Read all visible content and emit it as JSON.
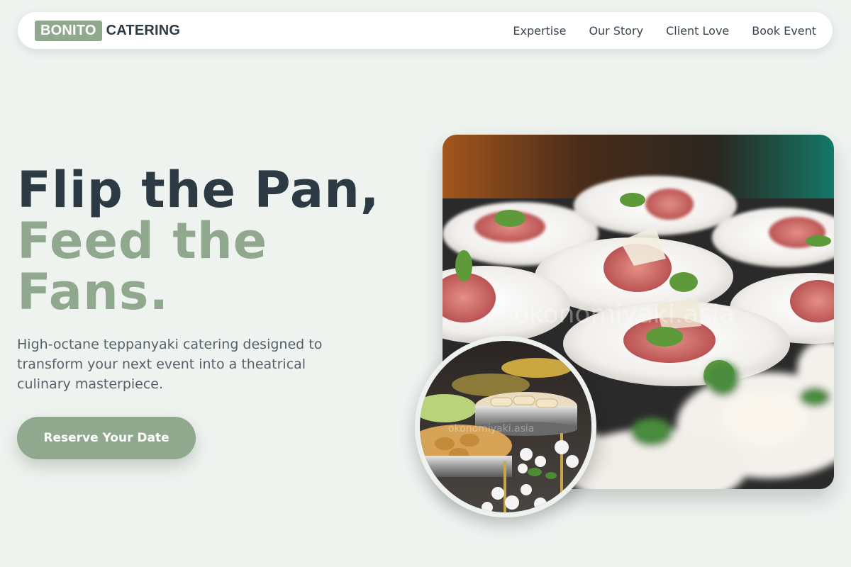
{
  "brand": {
    "badge": "BONITO",
    "name": "CATERING"
  },
  "nav": {
    "links": [
      "Expertise",
      "Our Story",
      "Client Love",
      "Book Event"
    ]
  },
  "hero": {
    "line1": "Flip the Pan,",
    "line2": "Feed the",
    "line3": "Fans.",
    "subtitle": "High-octane teppanyaki catering designed to transform your next event into a theatrical culinary masterpiece.",
    "cta": "Reserve Your Date"
  },
  "images": {
    "main_watermark": "okonomiyaki.asia",
    "circle_watermark": "okonomiyaki.asia"
  },
  "colors": {
    "accent": "#8fa88e",
    "text_dark": "#2c3a44",
    "background": "#eff3f0"
  }
}
